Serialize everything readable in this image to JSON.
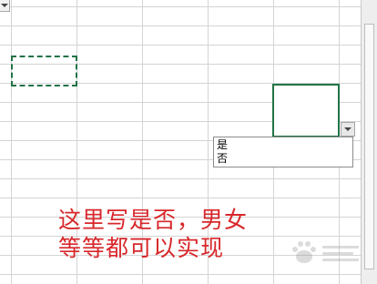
{
  "sheet": {
    "dropdown_options": [
      {
        "label": "是"
      },
      {
        "label": "否"
      }
    ]
  },
  "annotation": {
    "text": "这里写是否，男女等等都可以实现"
  },
  "icons": {
    "dropdown_arrow": "chevron-down-icon",
    "watermark_logo": "baidu-jingyan-logo"
  },
  "colors": {
    "selection_border": "#217346",
    "annotation_text": "#d8272b",
    "gridline": "#d4d4d4"
  }
}
